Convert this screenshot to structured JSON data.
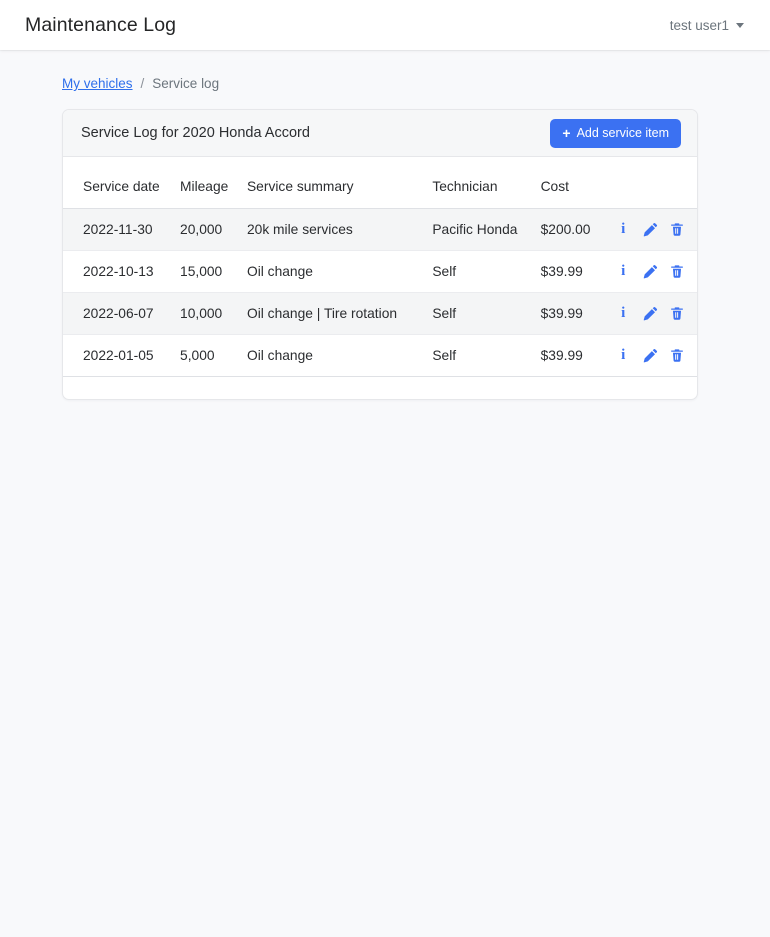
{
  "navbar": {
    "brand": "Maintenance Log",
    "user_label": "test user1",
    "caret_icon": "chevron-down-icon"
  },
  "breadcrumb": {
    "link_label": "My vehicles",
    "separator": "/",
    "current_label": "Service log"
  },
  "card": {
    "title": "Service Log for 2020 Honda Accord",
    "add_button_label": "Add service item",
    "add_button_icon": "plus-icon",
    "add_button_color": "#3b71f2"
  },
  "table": {
    "columns": [
      "Service date",
      "Mileage",
      "Service summary",
      "Technician",
      "Cost",
      ""
    ],
    "rows": [
      {
        "date": "2022-11-30",
        "mileage": "20,000",
        "summary": "20k mile services",
        "technician": "Pacific Honda",
        "cost": "$200.00"
      },
      {
        "date": "2022-10-13",
        "mileage": "15,000",
        "summary": "Oil change",
        "technician": "Self",
        "cost": "$39.99"
      },
      {
        "date": "2022-06-07",
        "mileage": "10,000",
        "summary": "Oil change | Tire rotation",
        "technician": "Self",
        "cost": "$39.99"
      },
      {
        "date": "2022-01-05",
        "mileage": "5,000",
        "summary": "Oil change",
        "technician": "Self",
        "cost": "$39.99"
      }
    ],
    "row_actions": {
      "info_icon": "info-icon",
      "info_glyph": "i",
      "edit_icon": "pencil-icon",
      "delete_icon": "trash-icon",
      "icon_color": "#3b71f2"
    }
  },
  "colors": {
    "page_background": "#f8f9fb",
    "navbar_background": "#ffffff",
    "card_header_background": "#f6f7f8",
    "stripe_background": "#f4f5f6",
    "link": "#2f6feb",
    "muted_text": "#6c757d"
  }
}
